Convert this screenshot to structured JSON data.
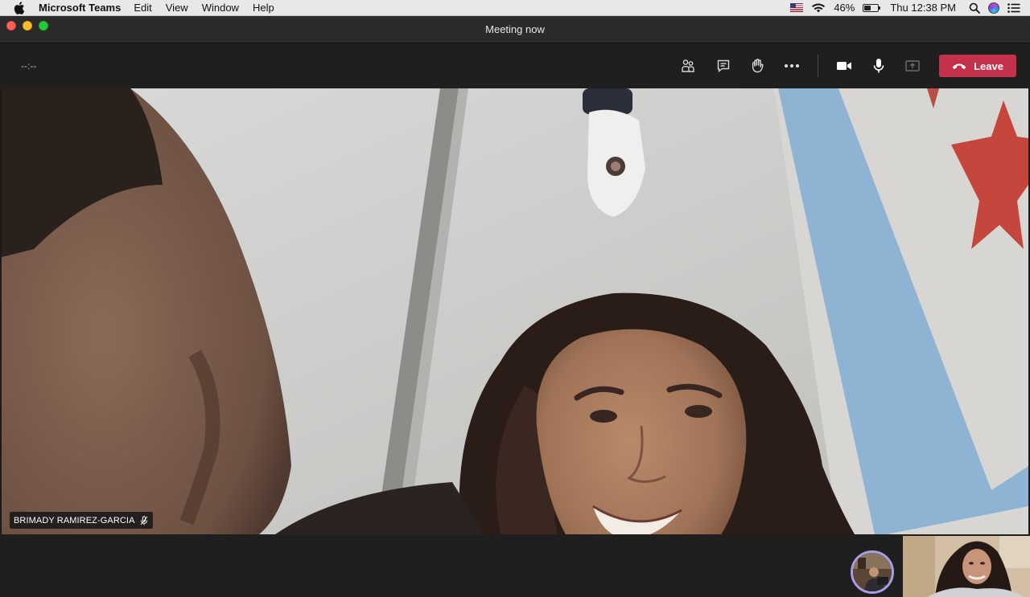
{
  "menubar": {
    "app_name": "Microsoft Teams",
    "menus": [
      "Edit",
      "View",
      "Window",
      "Help"
    ],
    "battery": "46%",
    "battery_level": 0.46,
    "clock": "Thu 12:38 PM"
  },
  "window": {
    "title": "Meeting now"
  },
  "meeting": {
    "timer": "--:--",
    "leave_label": "Leave",
    "participant_name": "BRIMADY RAMIREZ-GARCIA"
  },
  "icons": {
    "participants": "people-icon",
    "chat": "chat-icon",
    "raise_hand": "hand-icon",
    "more": "more-options-icon",
    "camera": "camera-icon",
    "mic": "microphone-icon",
    "share": "share-screen-icon",
    "leave": "phone-hangup-icon"
  },
  "colors": {
    "leave_button": "#c4314b",
    "avatar_ring": "#a79de8",
    "control_bar": "#1f1f1f"
  }
}
